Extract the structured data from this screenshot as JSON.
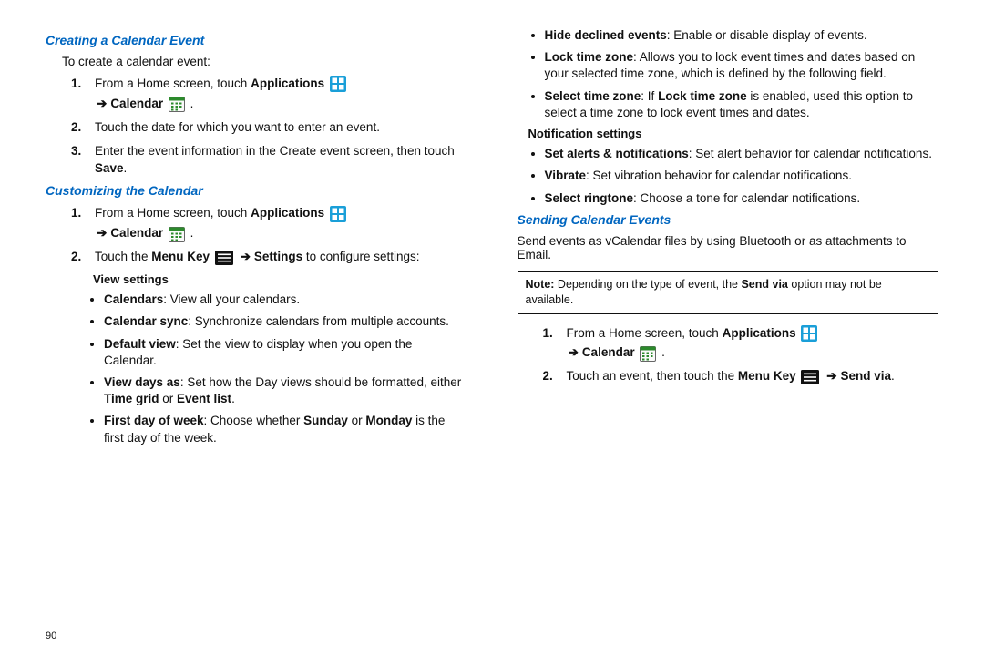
{
  "pageNumber": "90",
  "arrow": "➔",
  "headings": {
    "creating": "Creating a Calendar Event",
    "customizing": "Customizing the Calendar",
    "sending": "Sending Calendar Events"
  },
  "intro": {
    "creating": "To create a calendar event:",
    "sending": "Send events as vCalendar files by using Bluetooth or as attachments to Email."
  },
  "labels": {
    "Applications": "Applications",
    "Calendar": "Calendar",
    "MenuKey": "Menu Key",
    "Settings": "Settings",
    "Save": "Save",
    "SendVia": "Send via",
    "ViewSettings": "View settings",
    "NotificationSettings": "Notification settings"
  },
  "steps": {
    "create": {
      "n1": "1.",
      "s1a": "From a Home screen, touch ",
      "s1b": " .",
      "n2": "2.",
      "s2": "Touch the date for which you want to enter an event.",
      "n3": "3.",
      "s3a": "Enter the event information in the Create event screen, then touch "
    },
    "customize": {
      "n1": "1.",
      "s1a": "From a Home screen, touch ",
      "n2": "2.",
      "s2a": "Touch the ",
      "s2b": " to configure settings:"
    },
    "send": {
      "n1": "1.",
      "s1a": "From a Home screen, touch ",
      "n2": "2.",
      "s2a": "Touch an event, then touch the ",
      "s2b": "."
    }
  },
  "view": {
    "calendars": {
      "t": "Calendars",
      "d": ": View all your calendars."
    },
    "sync": {
      "t": "Calendar sync",
      "d": ": Synchronize calendars from multiple accounts."
    },
    "defaultView": {
      "t": "Default view",
      "d": ": Set the view to display when you open the Calendar."
    },
    "viewDays_pre": ": Set how the Day views should be formatted, either ",
    "viewDays_t": "View days as",
    "viewDays_tg": "Time grid",
    "viewDays_or": " or ",
    "viewDays_el": "Event list",
    "viewDays_post": ".",
    "firstDay_t": "First day of week",
    "firstDay_pre": ": Choose whether ",
    "firstDay_su": "Sunday",
    "firstDay_mid": " or ",
    "firstDay_mo": "Monday",
    "firstDay_post": " is the first day of the week."
  },
  "topBullets": {
    "hide": {
      "t": "Hide declined events",
      "d": ": Enable or disable display of events."
    },
    "lockTZ": {
      "t": "Lock time zone",
      "d": ": Allows you to lock event times and dates based on your selected time zone, which is defined by the following field."
    },
    "selectTZ_t": "Select time zone",
    "selectTZ_pre": ": If ",
    "selectTZ_lock": "Lock time zone",
    "selectTZ_post": " is enabled, used this option to select a time zone to lock event times and dates."
  },
  "notif": {
    "alerts": {
      "t": "Set alerts & notifications",
      "d": ": Set alert behavior for calendar notifications."
    },
    "vibrate": {
      "t": "Vibrate",
      "d": ": Set vibration behavior for calendar notifications."
    },
    "ringtone": {
      "t": "Select ringtone",
      "d": ": Choose a tone for calendar notifications."
    }
  },
  "note": {
    "label": "Note:",
    "pre": " Depending on the type of event, the ",
    "bold": "Send via",
    "post": " option may not be available."
  }
}
